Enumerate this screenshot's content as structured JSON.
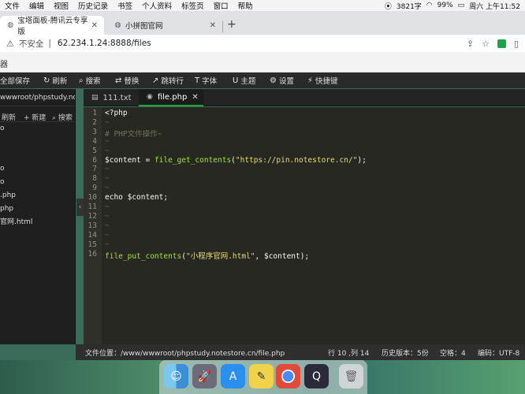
{
  "menubar": {
    "items": [
      "文件",
      "编辑",
      "视图",
      "历史记录",
      "书签",
      "个人资料",
      "标签页",
      "窗口",
      "帮助"
    ],
    "status_speed": "3821字",
    "battery": "99%",
    "clock": "周六 上午11:52"
  },
  "browser": {
    "tabs": [
      {
        "label": "宝塔面板-腾讯云专享版",
        "icon": "globe-icon"
      },
      {
        "label": "小拼图官网",
        "icon": "globe-icon"
      }
    ],
    "insecure_label": "不安全",
    "url": "62.234.1.24:8888/files"
  },
  "page_header": "器",
  "toolbar": {
    "save": "全部保存",
    "refresh": "刷新",
    "search": "搜索",
    "replace": "替换",
    "goto": "跳转行",
    "font": "字体",
    "theme": "主题",
    "settings": "设置",
    "shortcuts": "快捷键"
  },
  "filetree": {
    "path": "wwwroot/phpstudy.notestore...",
    "actions": {
      "refresh": "刷新",
      "new": "新建",
      "search": "搜索"
    },
    "items": [
      "o",
      "",
      "",
      "o",
      "o",
      ".php",
      "php",
      "官网.html"
    ]
  },
  "editor": {
    "tabs": [
      {
        "label": "111.txt",
        "active": false
      },
      {
        "label": "file.php",
        "active": true
      }
    ],
    "lines": [
      {
        "n": "1",
        "text": "<?php"
      },
      {
        "n": "2",
        "text": "~"
      },
      {
        "n": "3",
        "text": "# PHP文件操作~"
      },
      {
        "n": "4",
        "text": "~"
      },
      {
        "n": "5",
        "text": "~"
      },
      {
        "n": "6",
        "text": "$content = file_get_contents(\"https://pin.notestore.cn/\");"
      },
      {
        "n": "7",
        "text": "~"
      },
      {
        "n": "8",
        "text": "~"
      },
      {
        "n": "9",
        "text": "~"
      },
      {
        "n": "10",
        "text": "echo $content;"
      },
      {
        "n": "11",
        "text": "~"
      },
      {
        "n": "12",
        "text": "~"
      },
      {
        "n": "13",
        "text": "~"
      },
      {
        "n": "14",
        "text": "~"
      },
      {
        "n": "15",
        "text": "~"
      },
      {
        "n": "16",
        "text": "file_put_contents(\"小程序官网.html\", $content);"
      }
    ]
  },
  "statusbar": {
    "file_location": "文件位置：/www/wwwroot/phpstudy.notestore.cn/file.php",
    "cursor": "行 10 ,列 14",
    "history": "历史版本：5份",
    "indent": "空格：4",
    "encoding": "编码：UTF-8"
  },
  "dock": {
    "apps": [
      "finder-icon",
      "launchpad-icon",
      "app-store-icon",
      "stickies-icon",
      "chrome-icon",
      "quicktime-icon",
      "trash-icon"
    ]
  }
}
